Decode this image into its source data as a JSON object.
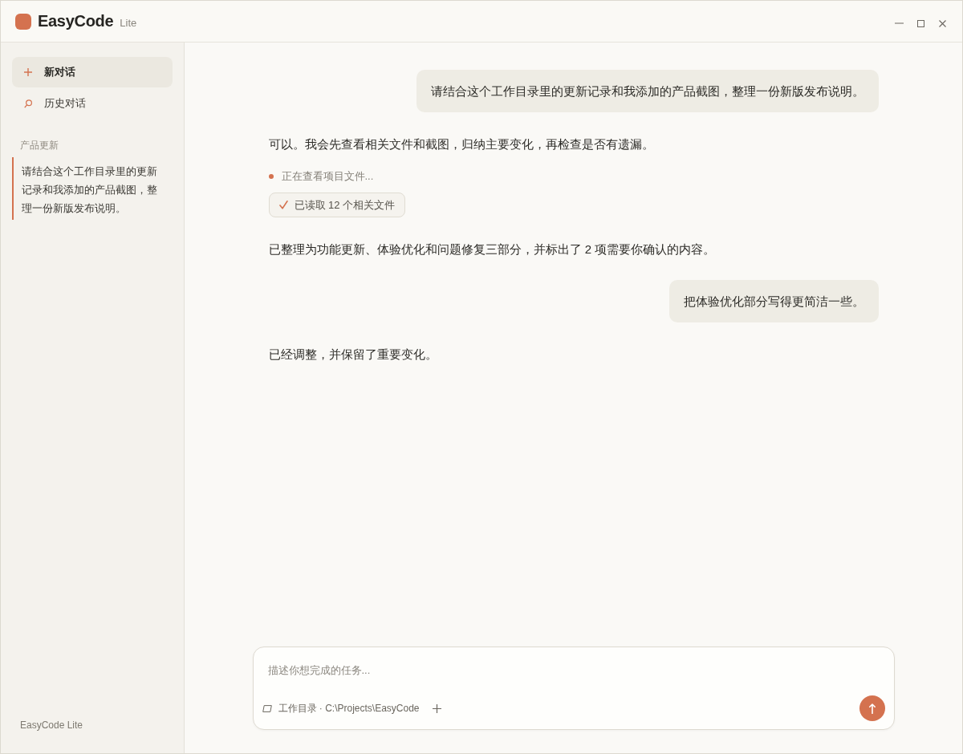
{
  "window": {
    "app_name": "EasyCode",
    "edition": "Lite"
  },
  "sidebar": {
    "actions": [
      {
        "kind": "new",
        "label": "新对话",
        "selected": true
      },
      {
        "kind": "history",
        "label": "历史对话",
        "selected": false
      }
    ],
    "sections": [
      {
        "title": "产品更新",
        "conversations": [
          {
            "title": "请结合这个工作目录里的更新记录和我添加的产品截图，整理一份新版发布说明。",
            "selected": true
          }
        ]
      }
    ],
    "footer": "EasyCode Lite"
  },
  "chat": {
    "messages": [
      {
        "kind": "user",
        "text": "请结合这个工作目录里的更新记录和我添加的产品截图，整理一份新版发布说明。"
      },
      {
        "kind": "assistant",
        "text": "可以。我会先查看相关文件和截图，归纳主要变化，再检查是否有遗漏。"
      },
      {
        "kind": "progress",
        "text": "正在查看项目文件..."
      },
      {
        "kind": "result",
        "text": "已读取 12 个相关文件"
      },
      {
        "kind": "assistant",
        "text": "已整理为功能更新、体验优化和问题修复三部分，并标出了 2 项需要你确认的内容。"
      },
      {
        "kind": "user",
        "text": "把体验优化部分写得更简洁一些。"
      },
      {
        "kind": "assistant",
        "text": "已经调整，并保留了重要变化。"
      }
    ]
  },
  "composer": {
    "placeholder": "描述你想完成的任务...",
    "workspace": "工作目录 · C:\\Projects\\EasyCode"
  }
}
